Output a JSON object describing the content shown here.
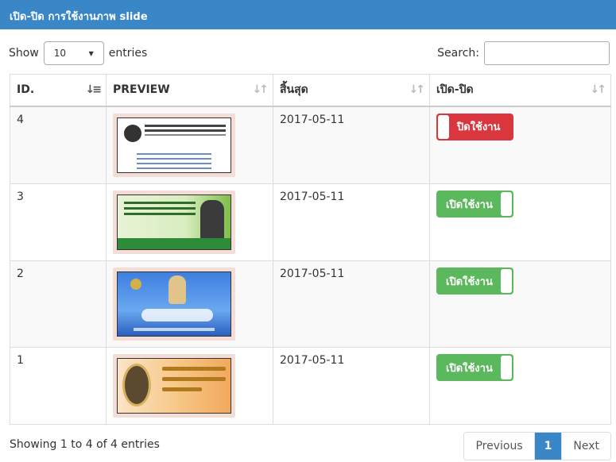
{
  "header": {
    "title": "เปิด-ปิด การใช้งานภาพ slide"
  },
  "length": {
    "show_label": "Show",
    "selected": "10",
    "entries_label": "entries"
  },
  "search": {
    "label": "Search:",
    "value": ""
  },
  "table": {
    "columns": [
      {
        "label": "ID."
      },
      {
        "label": "PREVIEW"
      },
      {
        "label": "สิ้นสุด"
      },
      {
        "label": "เปิด-ปิด"
      }
    ],
    "rows": [
      {
        "id": "4",
        "end": "2017-05-11",
        "toggle": "ปิดใช้งาน",
        "state": "off"
      },
      {
        "id": "3",
        "end": "2017-05-11",
        "toggle": "เปิดใช้งาน",
        "state": "on"
      },
      {
        "id": "2",
        "end": "2017-05-11",
        "toggle": "เปิดใช้งาน",
        "state": "on"
      },
      {
        "id": "1",
        "end": "2017-05-11",
        "toggle": "เปิดใช้งาน",
        "state": "on"
      }
    ]
  },
  "footer": {
    "info": "Showing 1 to 4 of 4 entries",
    "previous": "Previous",
    "page": "1",
    "next": "Next"
  },
  "colors": {
    "header": "#3a87c8",
    "toggle_on": "#5cb85c",
    "toggle_off": "#d9363e"
  }
}
